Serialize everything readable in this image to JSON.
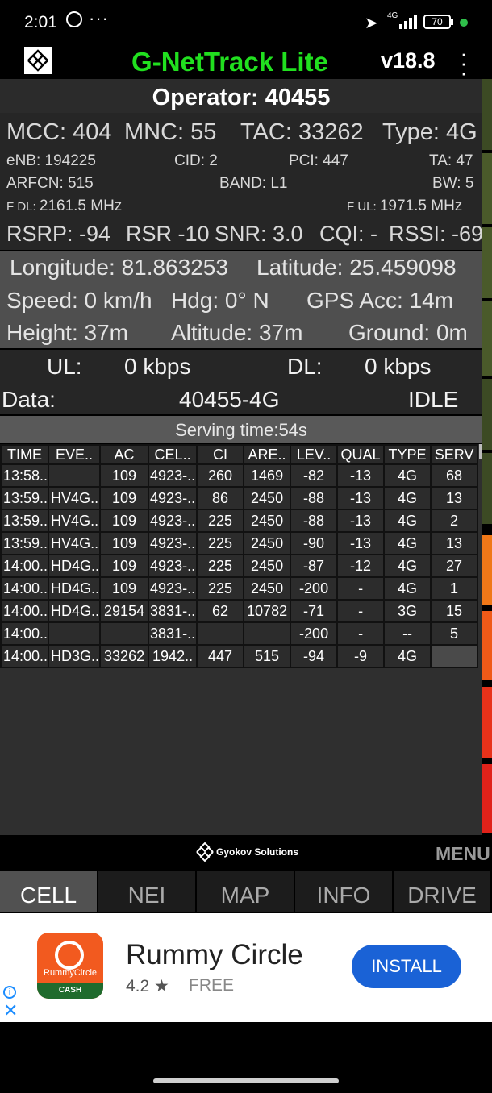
{
  "status_bar": {
    "time": "2:01",
    "overflow": "···",
    "net_type": "4G",
    "battery": "70"
  },
  "header": {
    "title": "G-NetTrack Lite",
    "version": "v18.8"
  },
  "operator": "Operator: 40455",
  "cell": {
    "mcc": "MCC: 404",
    "mnc": "MNC: 55",
    "tac": "TAC: 33262",
    "type": "Type: 4G",
    "enb": "eNB: 194225",
    "cid": "CID: 2",
    "pci": "PCI: 447",
    "ta": "TA: 47",
    "arfcn": "ARFCN: 515",
    "band": "BAND: L1",
    "bw": "BW: 5",
    "fdl_prefix": "F DL: ",
    "fdl": "2161.5 MHz",
    "ful_prefix": "F UL: ",
    "ful": "1971.5 MHz",
    "rsrp": "RSRP: -94",
    "rsr": "RSR -10",
    "snr": "SNR: 3.0",
    "cqi": "CQI: -",
    "rssi": "RSSI: -69"
  },
  "gps": {
    "longitude": "Longitude: 81.863253",
    "latitude": "Latitude: 25.459098",
    "speed": "Speed: 0 km/h",
    "hdg": "Hdg: 0° N",
    "gps_acc": "GPS Acc: 14m",
    "height": "Height: 37m",
    "altitude": "Altitude: 37m",
    "ground": "Ground: 0m"
  },
  "data": {
    "ul_label": "UL:",
    "ul_value": "0 kbps",
    "dl_label": "DL:",
    "dl_value": "0 kbps",
    "data_label": "Data:",
    "data_value": "40455-4G",
    "state": "IDLE"
  },
  "serving_time": "Serving time:54s",
  "table": {
    "headers": [
      "TIME",
      "EVE..",
      "AC",
      "CEL..",
      "CI",
      "ARE..",
      "LEV..",
      "QUAL",
      "TYPE",
      "SERV"
    ],
    "rows": [
      [
        "13:58..",
        "",
        "109",
        "4923-..",
        "260",
        "1469",
        "-82",
        "-13",
        "4G",
        "68"
      ],
      [
        "13:59..",
        "HV4G..",
        "109",
        "4923-..",
        "86",
        "2450",
        "-88",
        "-13",
        "4G",
        "13"
      ],
      [
        "13:59..",
        "HV4G..",
        "109",
        "4923-..",
        "225",
        "2450",
        "-88",
        "-13",
        "4G",
        "2"
      ],
      [
        "13:59..",
        "HV4G..",
        "109",
        "4923-..",
        "225",
        "2450",
        "-90",
        "-13",
        "4G",
        "13"
      ],
      [
        "14:00..",
        "HD4G..",
        "109",
        "4923-..",
        "225",
        "2450",
        "-87",
        "-12",
        "4G",
        "27"
      ],
      [
        "14:00..",
        "HD4G..",
        "109",
        "4923-..",
        "225",
        "2450",
        "-200",
        "-",
        "4G",
        "1"
      ],
      [
        "14:00..",
        "HD4G..",
        "29154",
        "3831-..",
        "62",
        "10782",
        "-71",
        "-",
        "3G",
        "15"
      ],
      [
        "14:00..",
        "",
        "",
        "3831-..",
        "",
        "",
        "-200",
        "-",
        "--",
        "5"
      ],
      [
        "14:00..",
        "HD3G..",
        "33262",
        "1942..",
        "447",
        "515",
        "-94",
        "-9",
        "4G",
        ""
      ]
    ]
  },
  "footer": {
    "brand": "Gyokov Solutions",
    "menu": "MENU"
  },
  "tabs": [
    "CELL",
    "NEI",
    "MAP",
    "INFO",
    "DRIVE"
  ],
  "ad": {
    "icon_text": "RummyCircle",
    "icon_badge": "CASH",
    "name": "Rummy Circle",
    "rating": "4.2 ★",
    "price": "FREE",
    "install": "INSTALL",
    "info_mark": "i",
    "close_mark": "✕"
  },
  "colors": {
    "title_green": "#21e01f",
    "install_blue": "#1a62d6",
    "strip_green": "#4a5a2a",
    "strip_orange": "#f07818",
    "strip_red": "#e0221a"
  }
}
